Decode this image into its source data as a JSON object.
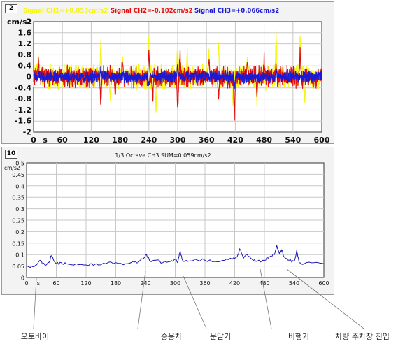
{
  "panel_ids": [
    "2",
    "10"
  ],
  "callouts": [
    {
      "label": "오토바이",
      "x": 50
    },
    {
      "label": "승용차",
      "x": 245
    },
    {
      "label": "문닫기",
      "x": 315
    },
    {
      "label": "비행기",
      "x": 427
    },
    {
      "label": "차량 주차장 진입",
      "x": 518
    }
  ],
  "chart_data": [
    {
      "type": "line",
      "title": "",
      "legend_position": "top",
      "series_labels": [
        {
          "text": "Signal CH1=+0.053cm/s2",
          "color": "#f5f51a"
        },
        {
          "text": "Signal CH2=-0.102cm/s2",
          "color": "#e01010"
        },
        {
          "text": "Signal CH3=+0.066cm/s2",
          "color": "#1a1ad6"
        }
      ],
      "ylabel": "cm/s2",
      "xunit": "s",
      "xlim": [
        0,
        600
      ],
      "ylim": [
        -2,
        2
      ],
      "xticks": [
        "0",
        "60",
        "120",
        "180",
        "240",
        "300",
        "360",
        "420",
        "480",
        "540",
        "600"
      ],
      "yticks": [
        "2",
        "1.6",
        "1.2",
        "0.8",
        "0.4",
        "0",
        "-0.4",
        "-0.8",
        "-1.2",
        "-1.6",
        "-2"
      ],
      "grid": true,
      "series": [
        {
          "name": "CH1",
          "color": "#f5f51a",
          "amplitude": 0.35,
          "peaks": [
            [
              10,
              0.9
            ],
            [
              140,
              1.8
            ],
            [
              160,
              -1.0
            ],
            [
              185,
              1.0
            ],
            [
              240,
              1.5
            ],
            [
              255,
              -1.4
            ],
            [
              300,
              1.6
            ],
            [
              320,
              1.2
            ],
            [
              365,
              1.0
            ],
            [
              385,
              1.6
            ],
            [
              415,
              -1.3
            ],
            [
              445,
              1.0
            ],
            [
              465,
              -1.2
            ],
            [
              505,
              1.9
            ],
            [
              555,
              1.7
            ],
            [
              565,
              -1.2
            ]
          ]
        },
        {
          "name": "CH2",
          "color": "#e01010",
          "amplitude": 0.3,
          "peaks": [
            [
              10,
              0.8
            ],
            [
              140,
              -1.2
            ],
            [
              170,
              -0.9
            ],
            [
              185,
              0.8
            ],
            [
              240,
              1.2
            ],
            [
              248,
              -1.1
            ],
            [
              300,
              -1.6
            ],
            [
              305,
              1.1
            ],
            [
              365,
              0.9
            ],
            [
              385,
              -1.0
            ],
            [
              418,
              -1.8
            ],
            [
              445,
              0.8
            ],
            [
              465,
              -0.8
            ],
            [
              480,
              0.9
            ],
            [
              505,
              0.7
            ],
            [
              555,
              1.1
            ]
          ]
        },
        {
          "name": "CH3",
          "color": "#1a1ad6",
          "amplitude": 0.18,
          "peaks": [
            [
              140,
              0.4
            ],
            [
              240,
              -0.4
            ],
            [
              300,
              0.5
            ],
            [
              418,
              -0.5
            ],
            [
              505,
              0.4
            ]
          ]
        }
      ]
    },
    {
      "type": "line",
      "title": "1/3 Octave CH3 SUM=0.059cm/s2",
      "ylabel": "cm/s2",
      "xunit": "s",
      "xlim": [
        0,
        600
      ],
      "ylim": [
        0,
        0.5
      ],
      "xticks": [
        "0",
        "60",
        "120",
        "180",
        "240",
        "300",
        "360",
        "420",
        "480",
        "540",
        "600"
      ],
      "yticks": [
        "0.5",
        "0.45",
        "0.4",
        "0.35",
        "0.3",
        "0.25",
        "0.2",
        "0.15",
        "0.1",
        "0.05",
        "0"
      ],
      "grid": true,
      "series": [
        {
          "name": "CH3",
          "color": "#1a1ab0",
          "x": [
            0,
            10,
            20,
            28,
            33,
            40,
            45,
            50,
            60,
            70,
            80,
            100,
            120,
            140,
            160,
            180,
            200,
            215,
            225,
            235,
            242,
            250,
            260,
            275,
            290,
            300,
            305,
            310,
            315,
            325,
            340,
            360,
            380,
            400,
            415,
            425,
            430,
            438,
            445,
            455,
            465,
            480,
            490,
            500,
            505,
            510,
            515,
            520,
            530,
            540,
            545,
            550,
            560,
            580,
            600
          ],
          "y": [
            0.05,
            0.05,
            0.055,
            0.075,
            0.06,
            0.055,
            0.065,
            0.095,
            0.06,
            0.065,
            0.06,
            0.06,
            0.055,
            0.06,
            0.06,
            0.065,
            0.06,
            0.07,
            0.065,
            0.08,
            0.1,
            0.07,
            0.075,
            0.065,
            0.07,
            0.08,
            0.065,
            0.115,
            0.075,
            0.07,
            0.08,
            0.075,
            0.07,
            0.075,
            0.08,
            0.09,
            0.125,
            0.085,
            0.1,
            0.08,
            0.07,
            0.075,
            0.09,
            0.1,
            0.14,
            0.105,
            0.12,
            0.09,
            0.075,
            0.07,
            0.115,
            0.065,
            0.06,
            0.065,
            0.06
          ]
        }
      ]
    }
  ]
}
